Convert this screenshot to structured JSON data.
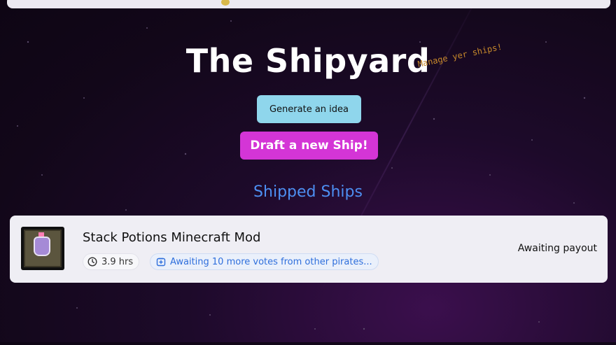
{
  "header": {
    "title": "The Shipyard",
    "tagline": "Manage yer ships!"
  },
  "actions": {
    "idea_label": "Generate an idea",
    "draft_label": "Draft a new Ship!"
  },
  "section": {
    "title": "Shipped Ships"
  },
  "ships": [
    {
      "name": "Stack Potions Minecraft Mod",
      "hours": "3.9 hrs",
      "votes_status": "Awaiting 10 more votes from other pirates...",
      "payout_status": "Awaiting payout",
      "thumbnail_icon": "potion-icon"
    }
  ],
  "colors": {
    "idea_button": "#8fd6ec",
    "draft_button": "#d435d6",
    "section_title": "#4d8ff2",
    "tagline": "#c7892b",
    "card": "#efeef4"
  }
}
